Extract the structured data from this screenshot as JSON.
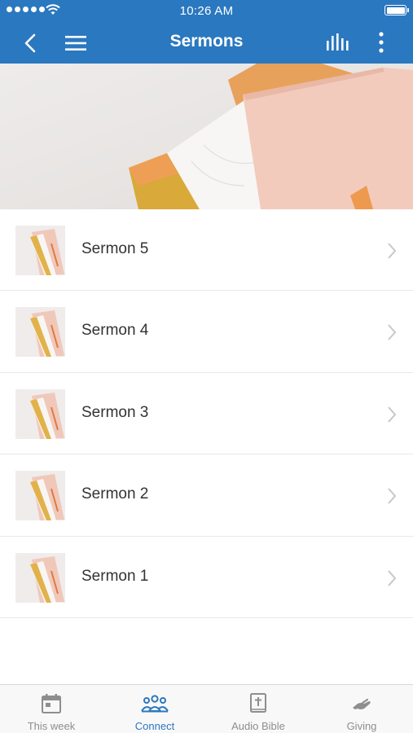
{
  "status_bar": {
    "time": "10:26 AM"
  },
  "nav": {
    "title": "Sermons"
  },
  "sermons": [
    {
      "title": "Sermon 5"
    },
    {
      "title": "Sermon 4"
    },
    {
      "title": "Sermon 3"
    },
    {
      "title": "Sermon 2"
    },
    {
      "title": "Sermon 1"
    }
  ],
  "tabs": [
    {
      "label": "This week",
      "icon": "calendar-icon"
    },
    {
      "label": "Connect",
      "icon": "people-icon",
      "active": true
    },
    {
      "label": "Audio Bible",
      "icon": "bible-icon"
    },
    {
      "label": "Giving",
      "icon": "giving-hand-icon"
    }
  ],
  "colors": {
    "brand": "#2a78bf",
    "tab_inactive": "#8e8e8e",
    "text": "#333333"
  }
}
